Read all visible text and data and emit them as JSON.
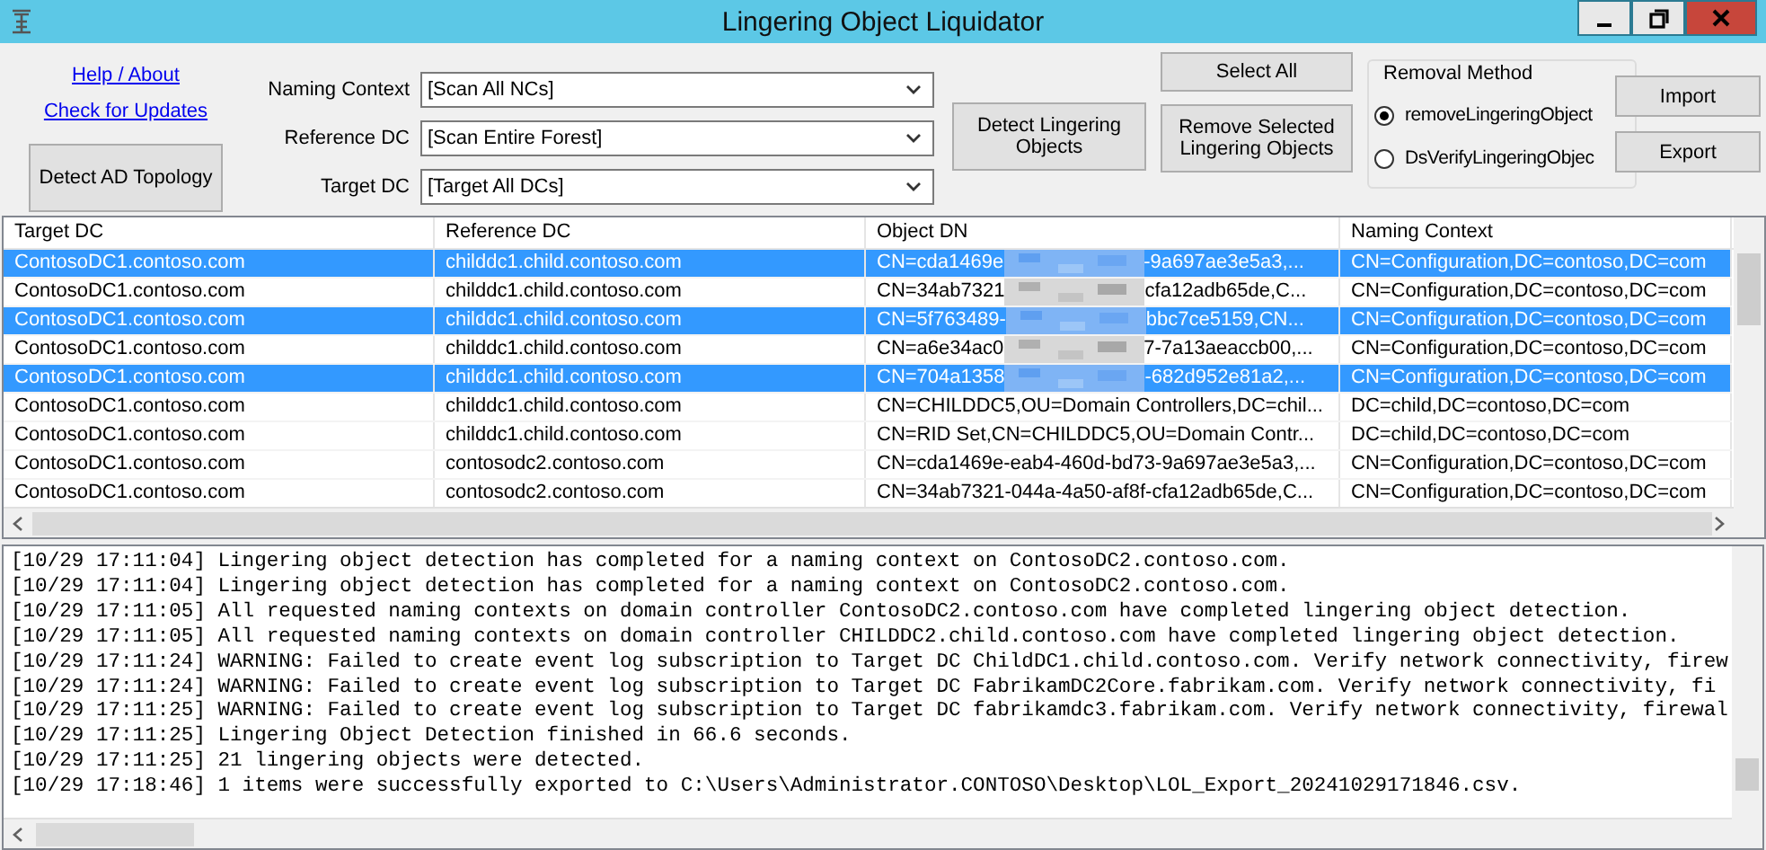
{
  "window": {
    "title": "Lingering Object Liquidator"
  },
  "links": [
    "Help / About",
    "Check for Updates"
  ],
  "detect_topology_button": "Detect AD Topology",
  "fields": [
    {
      "label": "Naming Context",
      "value": "[Scan All NCs]"
    },
    {
      "label": "Reference DC",
      "value": "[Scan Entire Forest]"
    },
    {
      "label": "Target DC",
      "value": "[Target All DCs]"
    }
  ],
  "detect_button": "Detect Lingering Objects",
  "select_all_button": "Select All",
  "remove_button": "Remove Selected Lingering Objects",
  "removal_method": {
    "title": "Removal Method",
    "options": [
      {
        "label": "removeLingeringObject",
        "selected": true
      },
      {
        "label": "DsVerifyLingeringObjec",
        "selected": false
      }
    ]
  },
  "import_button": "Import",
  "export_button": "Export",
  "table": {
    "columns": [
      "Target DC",
      "Reference DC",
      "Object DN",
      "Naming Context"
    ],
    "rows": [
      {
        "selected": true,
        "target": "ContosoDC1.contoso.com",
        "reference": "childdc1.child.contoso.com",
        "dn_start": "CN=cda1469e",
        "dn_end": "-9a697ae3e5a3,...",
        "redacted": true,
        "nc": "CN=Configuration,DC=contoso,DC=com"
      },
      {
        "selected": false,
        "target": "ContosoDC1.contoso.com",
        "reference": "childdc1.child.contoso.com",
        "dn_start": "CN=34ab7321",
        "dn_end": "cfa12adb65de,C...",
        "redacted": true,
        "nc": "CN=Configuration,DC=contoso,DC=com"
      },
      {
        "selected": true,
        "target": "ContosoDC1.contoso.com",
        "reference": "childdc1.child.contoso.com",
        "dn_start": "CN=5f763489-",
        "dn_end": "bbc7ce5159,CN...",
        "redacted": true,
        "nc": "CN=Configuration,DC=contoso,DC=com"
      },
      {
        "selected": false,
        "target": "ContosoDC1.contoso.com",
        "reference": "childdc1.child.contoso.com",
        "dn_start": "CN=a6e34ac0",
        "dn_end": "7-7a13aeaccb00,...",
        "redacted": true,
        "nc": "CN=Configuration,DC=contoso,DC=com"
      },
      {
        "selected": true,
        "target": "ContosoDC1.contoso.com",
        "reference": "childdc1.child.contoso.com",
        "dn_start": "CN=704a1358",
        "dn_end": "-682d952e81a2,...",
        "redacted": true,
        "nc": "CN=Configuration,DC=contoso,DC=com"
      },
      {
        "selected": false,
        "target": "ContosoDC1.contoso.com",
        "reference": "childdc1.child.contoso.com",
        "dn_start": "CN=CHILDDC5,OU=Domain Controllers,DC=chil...",
        "redacted": false,
        "nc": "DC=child,DC=contoso,DC=com"
      },
      {
        "selected": false,
        "target": "ContosoDC1.contoso.com",
        "reference": "childdc1.child.contoso.com",
        "dn_start": "CN=RID Set,CN=CHILDDC5,OU=Domain Contr...",
        "redacted": false,
        "nc": "DC=child,DC=contoso,DC=com"
      },
      {
        "selected": false,
        "target": "ContosoDC1.contoso.com",
        "reference": "contosodc2.contoso.com",
        "dn_start": "CN=cda1469e-eab4-460d-bd73-9a697ae3e5a3,...",
        "redacted": false,
        "nc": "CN=Configuration,DC=contoso,DC=com"
      },
      {
        "selected": false,
        "target": "ContosoDC1.contoso.com",
        "reference": "contosodc2.contoso.com",
        "dn_start": "CN=34ab7321-044a-4a50-af8f-cfa12adb65de,C...",
        "redacted": false,
        "nc": "CN=Configuration,DC=contoso,DC=com"
      }
    ]
  },
  "log": [
    "[10/29 17:11:04] Lingering object detection has completed for a naming context on ContosoDC2.contoso.com.",
    "[10/29 17:11:04] Lingering object detection has completed for a naming context on ContosoDC2.contoso.com.",
    "[10/29 17:11:05] All requested naming contexts on domain controller ContosoDC2.contoso.com have completed lingering object detection.",
    "[10/29 17:11:05] All requested naming contexts on domain controller CHILDDC2.child.contoso.com have completed lingering object detection.",
    "[10/29 17:11:24] WARNING: Failed to create event log subscription to Target DC ChildDC1.child.contoso.com. Verify network connectivity, firew",
    "[10/29 17:11:24] WARNING: Failed to create event log subscription to Target DC FabrikamDC2Core.fabrikam.com. Verify network connectivity, fi",
    "[10/29 17:11:25] WARNING: Failed to create event log subscription to Target DC fabrikamdc3.fabrikam.com. Verify network connectivity, firewal",
    "[10/29 17:11:25] Lingering Object Detection finished in 66.6 seconds.",
    "[10/29 17:11:25] 21 lingering objects were detected.",
    "[10/29 17:18:46] 1 items were successfully exported to C:\\Users\\Administrator.CONTOSO\\Desktop\\LOL_Export_20241029171846.csv."
  ]
}
